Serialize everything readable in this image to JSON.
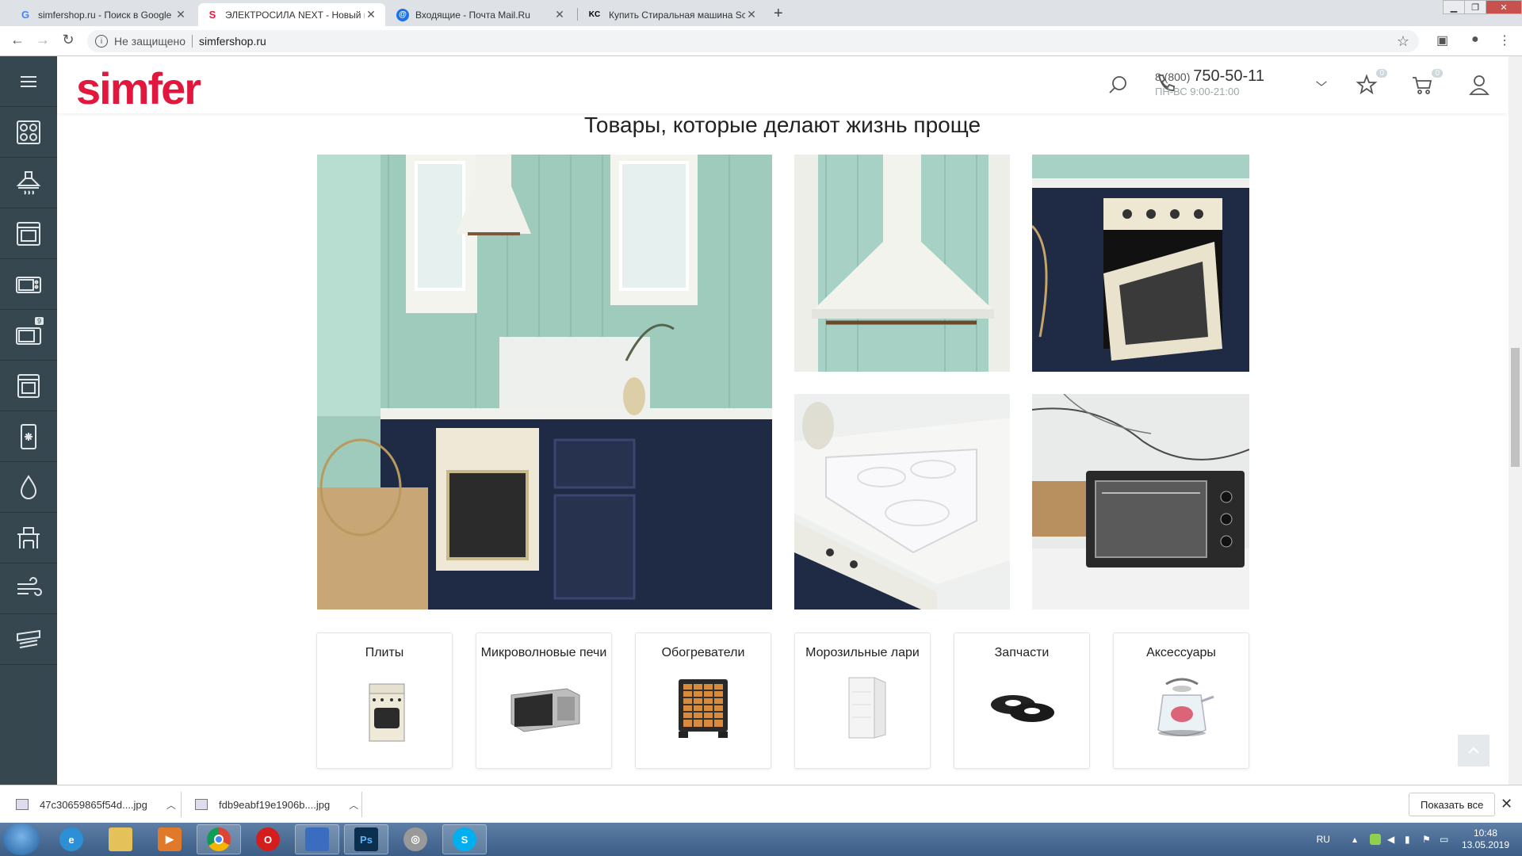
{
  "browser": {
    "tabs": [
      {
        "title": "simfershop.ru - Поиск в Google",
        "icon": "google-icon"
      },
      {
        "title": "ЭЛЕКТРОСИЛА NEXT - Новый и",
        "icon": "simfer-icon",
        "active": true
      },
      {
        "title": "Входящие - Почта Mail.Ru",
        "icon": "mail-icon"
      },
      {
        "title": "Купить Стиральная машина Sch",
        "icon": "kc-icon"
      }
    ],
    "security_label": "Не защищено",
    "url": "simfershop.ru"
  },
  "sidebar": {
    "items": [
      {
        "icon": "cooktop-icon"
      },
      {
        "icon": "hood-icon"
      },
      {
        "icon": "oven-icon"
      },
      {
        "icon": "mini-oven-icon"
      },
      {
        "icon": "microwave-icon",
        "badge": "9"
      },
      {
        "icon": "built-in-oven-icon"
      },
      {
        "icon": "freezer-icon"
      },
      {
        "icon": "water-heater-icon"
      },
      {
        "icon": "furniture-icon"
      },
      {
        "icon": "fan-icon"
      },
      {
        "icon": "air-conditioner-icon"
      }
    ]
  },
  "header": {
    "logo": "simfer",
    "phone_prefix": "8 (800)",
    "phone_number": "750-50-11",
    "hours": "ПН-ВС 9:00-21:00",
    "favorites_count": "0",
    "cart_count": "0"
  },
  "main": {
    "title": "Товары, которые делают жизнь проще",
    "categories": [
      {
        "name": "Плиты",
        "icon": "stove-icon"
      },
      {
        "name": "Микроволновые печи",
        "icon": "microwave-icon"
      },
      {
        "name": "Обогреватели",
        "icon": "heater-icon"
      },
      {
        "name": "Морозильные лари",
        "icon": "freezer-icon"
      },
      {
        "name": "Запчасти",
        "icon": "filter-icon"
      },
      {
        "name": "Аксессуары",
        "icon": "kettle-icon"
      }
    ]
  },
  "downloads": {
    "files": [
      "47c30659865f54d....jpg",
      "fdb9eabf19e1906b....jpg"
    ],
    "show_all": "Показать все"
  },
  "taskbar": {
    "lang": "RU",
    "time": "10:48",
    "date": "13.05.2019"
  },
  "colors": {
    "brand": "#e2173d",
    "sidebar": "#36474f",
    "cabinet_navy": "#1f2a44",
    "wall_mint": "#a9d3c6"
  }
}
